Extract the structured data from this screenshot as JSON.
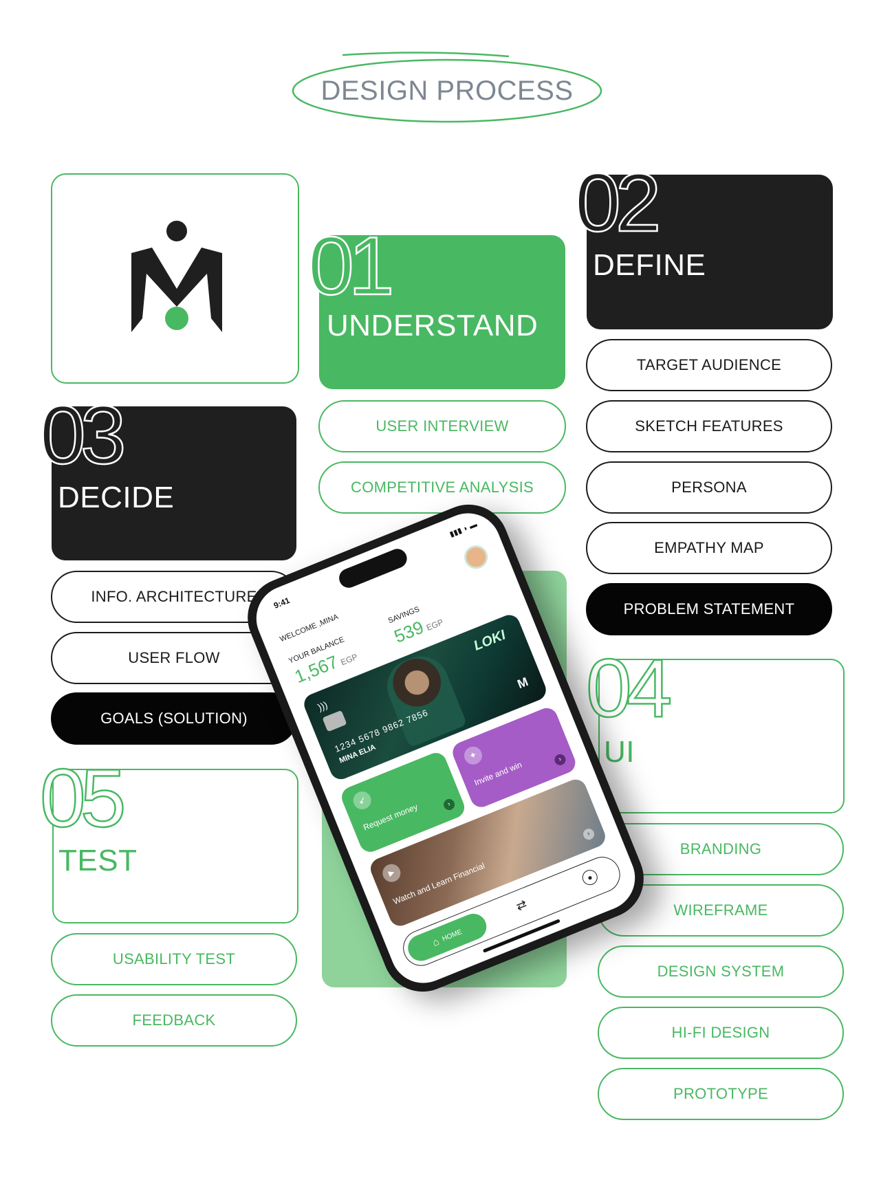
{
  "title": "DESIGN PROCESS",
  "colors": {
    "green": "#49b862",
    "dark": "#1f1f1f",
    "black": "#050505",
    "light_green": "#8fd39b",
    "purple": "#a55cc7",
    "title_gray": "#7d8792"
  },
  "understand": {
    "number": "01",
    "label": "UNDERSTAND",
    "items": [
      "USER INTERVIEW",
      "COMPETITIVE ANALYSIS"
    ]
  },
  "define": {
    "number": "02",
    "label": "DEFINE",
    "items": [
      "TARGET AUDIENCE",
      "SKETCH FEATURES",
      "PERSONA",
      "EMPATHY MAP",
      "PROBLEM STATEMENT"
    ]
  },
  "decide": {
    "number": "03",
    "label": "DECIDE",
    "items": [
      "INFO. ARCHITECTURE",
      "USER FLOW",
      "GOALS (SOLUTION)"
    ]
  },
  "ui": {
    "number": "04",
    "label": "UI",
    "items": [
      "BRANDING",
      "WIREFRAME",
      "DESIGN SYSTEM",
      "HI-FI DESIGN",
      "PROTOTYPE"
    ]
  },
  "test": {
    "number": "05",
    "label": "TEST",
    "items": [
      "USABILITY TEST",
      "FEEDBACK"
    ]
  },
  "logo": {
    "icon": "m-person-logo-icon"
  },
  "phone": {
    "time": "9:41",
    "welcome": "WELCOME ,MINA",
    "balance_label": "YOUR BALANCE",
    "balance_value": "1,567",
    "savings_label": "SAVINGS",
    "savings_value": "539",
    "currency": "EGP",
    "card_brand": "LOKI",
    "card_number": "1234 5678 9862 7856",
    "card_holder": "MINA ELIA",
    "request_label": "Request money",
    "invite_label": "Invite and win",
    "watch_label": "Watch and Learn Financial",
    "nav_home": "HOME"
  }
}
